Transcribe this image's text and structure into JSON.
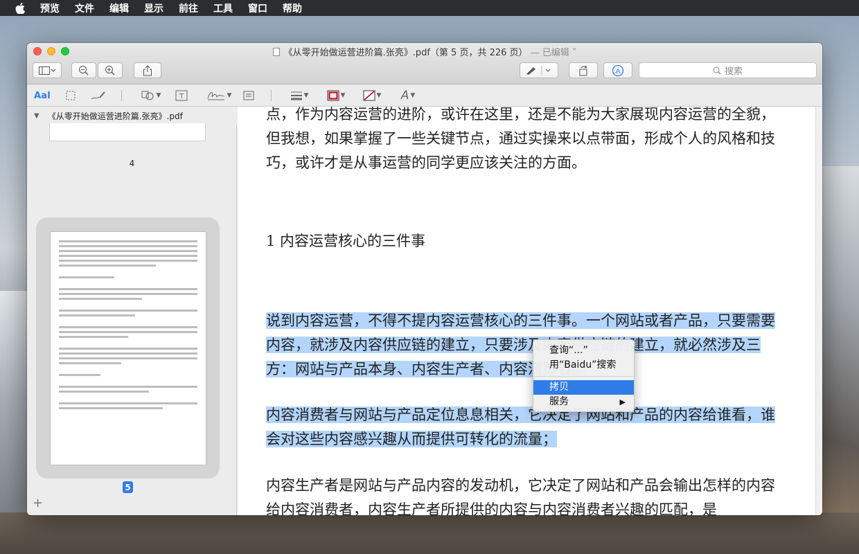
{
  "menubar": {
    "items": [
      "预览",
      "文件",
      "编辑",
      "显示",
      "前往",
      "工具",
      "窗口",
      "帮助"
    ]
  },
  "window": {
    "title": "《从零开始做运营进阶篇.张亮》.pdf（第 5 页，共 226 页）",
    "edited": "— 已编辑 ˅",
    "search_placeholder": "搜索"
  },
  "sidebar": {
    "file_name": "《从零开始做运营进阶篇.张亮》.pdf",
    "prev_page_number": "4",
    "current_page_number": "5",
    "add_label": "+"
  },
  "markup": {
    "text_tool_label": "AaI",
    "font_tool_label": "A"
  },
  "document": {
    "p1": "点，作为内容运营的进阶，或许在这里，还是不能为大家展现内容运营的全貌，但我想，如果掌握了一些关键节点，通过实操来以点带面，形成个人的风格和技巧，或许才是从事运营的同学更应该关注的方面。",
    "heading": "1 内容运营核心的三件事",
    "p2": "说到内容运营，不得不提内容运营核心的三件事。一个网站或者产品，只要需要内容，就涉及内容供应链的建立，只要涉及内容供应链的建立，就必然涉及三方：网站与产品本身、内容生产者、内容消费者。",
    "p3": "内容消费者与网站与产品定位息息相关，它决定了网站和产品的内容给谁看，谁会对这些内容感兴趣从而提供可转化的流量；",
    "p4": "内容生产者是网站与产品内容的发动机，它决定了网站和产品会输出怎样的内容给内容消费者，内容生产者所提供的内容与内容消费者兴趣的匹配，是"
  },
  "context_menu": {
    "lookup": "查询“...”",
    "search_baidu": "用“Baidu”搜索",
    "copy": "拷贝",
    "services": "服务"
  },
  "colors": {
    "accent": "#2f7ce8",
    "highlight": "#b3d5fb"
  }
}
